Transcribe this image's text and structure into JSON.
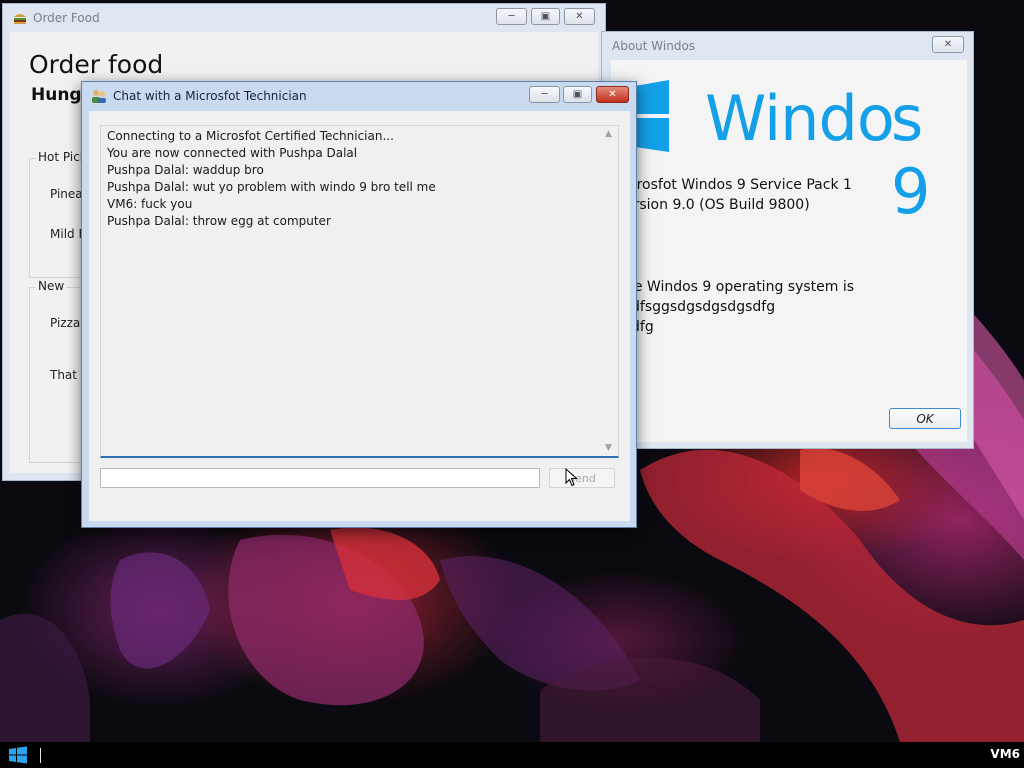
{
  "order_window": {
    "title": "Order Food",
    "heading": "Order food",
    "subheading": "Hungr",
    "hot_group": {
      "label": "Hot Pick",
      "items": [
        "Pinea",
        "Mild E"
      ]
    },
    "new_group": {
      "label": "New",
      "items": [
        "Pizza",
        "That z"
      ]
    },
    "icon": "burger-icon"
  },
  "about_window": {
    "title": "About Windos",
    "logo_text": "Windo",
    "logo_suffix": "s 9",
    "lines": [
      "icrosfot Windos 9 Service Pack 1",
      "ersion 9.0 (OS Build 9800)",
      "ne Windos 9 operating system is",
      "dfsggsdgsdgsdgsdfg",
      "dfg",
      "l"
    ],
    "ok_label": "OK",
    "logo_color": "#13a0e8"
  },
  "chat_window": {
    "title": "Chat with a Microsfot Technician",
    "icon": "users-icon",
    "messages": [
      "Connecting to a Microsfot Certified Technician...",
      "You are now connected with Pushpa Dalal",
      "Pushpa Dalal: waddup bro",
      "Pushpa Dalal: wut yo problem with windo 9 bro tell me",
      "VM6: fuck you",
      "Pushpa Dalal: throw egg at computer"
    ],
    "input_value": "",
    "send_label": "Send",
    "accent_color": "#2f6fb0"
  },
  "taskbar": {
    "start_icon": "windows-logo-icon",
    "label": "VM6"
  }
}
